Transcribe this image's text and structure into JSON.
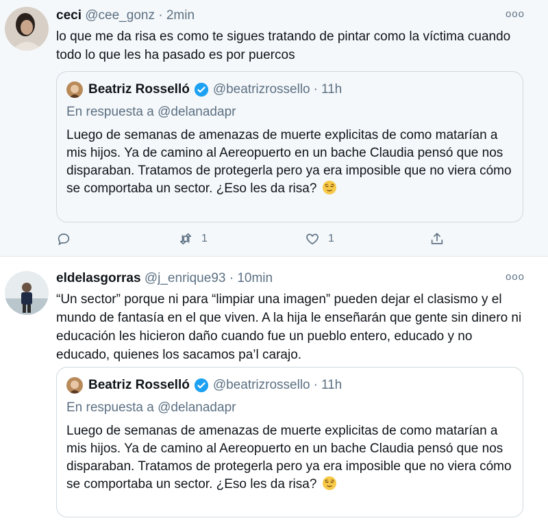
{
  "tweets": [
    {
      "name": "ceci",
      "handle": "@cee_gonz",
      "time": "2min",
      "text": "lo que me da risa es como te sigues tratando de pintar como la víctima cuando todo lo que les ha pasado es por puercos",
      "quote": {
        "name": "Beatriz Rosselló",
        "handle": "@beatrizrossello",
        "time": "11h",
        "reply_prefix": "En respuesta a",
        "reply_to": "@delanadapr",
        "text": "Luego de semanas de amenazas de muerte explicitas de como matarían a mis hijos. Ya de camino al Aereopuerto en un bache Claudia pensó que nos disparaban. Tratamos de protegerla pero ya era imposible que no viera cómo se comportaba un sector.  ¿Eso les da risa?"
      },
      "actions": {
        "retweets": "1",
        "likes": "1"
      }
    },
    {
      "name": "eldelasgorras",
      "handle": "@j_enrique93",
      "time": "10min",
      "text": "“Un sector” porque ni para “limpiar una imagen” pueden dejar el clasismo y el mundo de fantasía en el que viven. A la hija le enseñarán que gente sin dinero ni educación les hicieron daño cuando fue un pueblo entero, educado y no educado, quienes los sacamos pa’l carajo.",
      "quote": {
        "name": "Beatriz Rosselló",
        "handle": "@beatrizrossello",
        "time": "11h",
        "reply_prefix": "En respuesta a",
        "reply_to": "@delanadapr",
        "text": "Luego de semanas de amenazas de muerte explicitas de como matarían a mis hijos. Ya de camino al Aereopuerto en un bache Claudia pensó que nos disparaban. Tratamos de protegerla pero ya era imposible que no viera cómo se comportaba un sector.  ¿Eso les da risa?"
      }
    }
  ],
  "sep": "·",
  "more": "ooo",
  "colors": {
    "accent": "#1da1f2",
    "muted": "#5b7083",
    "hover_bg": "#f5f8fa"
  }
}
